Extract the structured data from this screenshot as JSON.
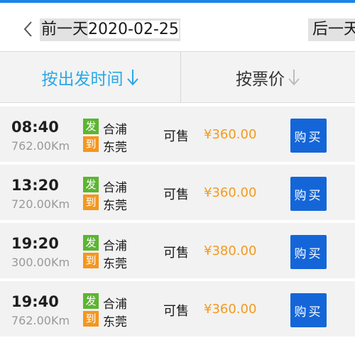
{
  "datebar": {
    "prev_label": "前一天",
    "date": "2020-02-25",
    "next_label": "后一天"
  },
  "sortbar": {
    "by_time": "按出发时间",
    "by_price": "按票价"
  },
  "colors": {
    "accent_blue": "#29a8e6",
    "buy_button": "#1466d8",
    "price_orange": "#f39a1e",
    "from_tag_green": "#5cb531",
    "to_tag_orange": "#f5961e"
  },
  "icons": [
    "back-chevron-icon",
    "sort-down-arrow-icon"
  ],
  "trips": [
    {
      "time": "08:40",
      "distance": "762.00Km",
      "from_tag": "发",
      "from": "合浦",
      "to_tag": "到",
      "to": "东莞",
      "status": "可售",
      "price": "¥360.00",
      "buy": "购买"
    },
    {
      "time": "13:20",
      "distance": "720.00Km",
      "from_tag": "发",
      "from": "合浦",
      "to_tag": "到",
      "to": "东莞",
      "status": "可售",
      "price": "¥360.00",
      "buy": "购买"
    },
    {
      "time": "19:20",
      "distance": "300.00Km",
      "from_tag": "发",
      "from": "合浦",
      "to_tag": "到",
      "to": "东莞",
      "status": "可售",
      "price": "¥380.00",
      "buy": "购买"
    },
    {
      "time": "19:40",
      "distance": "762.00Km",
      "from_tag": "发",
      "from": "合浦",
      "to_tag": "到",
      "to": "东莞",
      "status": "可售",
      "price": "¥360.00",
      "buy": "购买"
    }
  ]
}
